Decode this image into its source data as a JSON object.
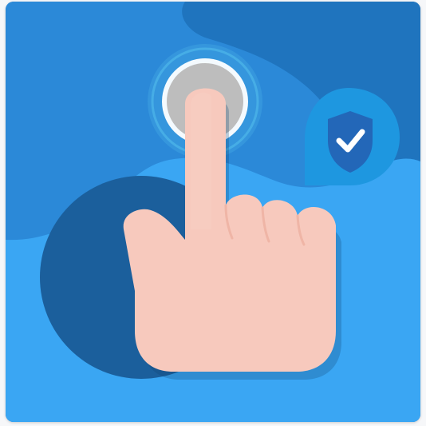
{
  "illustration": {
    "subject": "touch-verification",
    "icons": [
      "tap-ripple-icon",
      "pointing-hand-icon",
      "shield-check-icon"
    ],
    "colors": {
      "background": "#2b89d8",
      "dark_blob": "#1f74be",
      "light_blob": "#3aa6f3",
      "circle_dark": "#1b5f9c",
      "skin": "#f7c9bd",
      "ripple_ring": "#4fb7e9",
      "touch_point": "#bdbdbd",
      "badge": "#1e97e0",
      "shield": "#2367b8",
      "check": "#ffffff"
    }
  }
}
